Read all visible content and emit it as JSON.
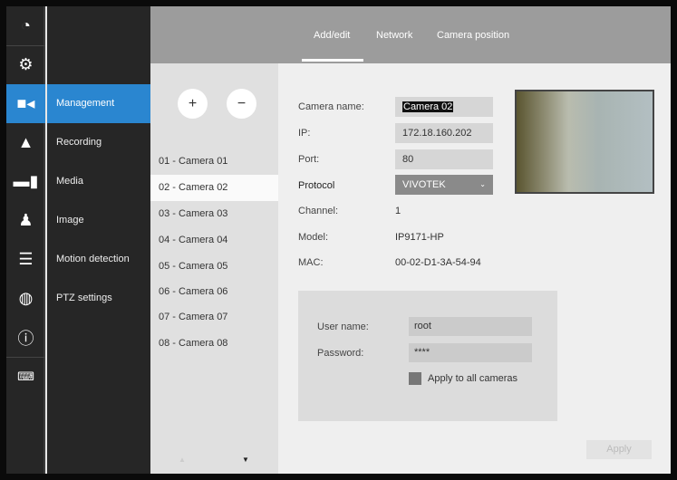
{
  "icons": [
    "live-view-icon",
    "settings-icon",
    "camera-icon",
    "alert-bell-icon",
    "computer-icon",
    "user-icon",
    "database-icon",
    "globe-icon",
    "info-icon",
    "keyboard-icon"
  ],
  "nav": [
    "Management",
    "Recording",
    "Media",
    "Image",
    "Motion detection",
    "PTZ settings"
  ],
  "tabs": [
    "Add/edit",
    "Network",
    "Camera position"
  ],
  "camera_list": {
    "add": "+",
    "remove": "−",
    "items": [
      "01 - Camera 01",
      "02 - Camera 02",
      "03 - Camera 03",
      "04 - Camera 04",
      "05 - Camera 05",
      "06 - Camera 06",
      "07 - Camera 07",
      "08 - Camera 08"
    ],
    "selected": 1
  },
  "form": {
    "camera_name_label": "Camera name:",
    "camera_name": "Camera 02",
    "ip_label": "IP:",
    "ip": "172.18.160.202",
    "port_label": "Port:",
    "port": "80",
    "protocol_label": "Protocol",
    "protocol": "VIVOTEK",
    "channel_label": "Channel:",
    "channel": "1",
    "model_label": "Model:",
    "model": "IP9171-HP",
    "mac_label": "MAC:",
    "mac": "00-02-D1-3A-54-94"
  },
  "credentials": {
    "user_label": "User name:",
    "user": "root",
    "password_label": "Password:",
    "password": "****",
    "apply_all": "Apply to all cameras"
  },
  "apply": "Apply"
}
